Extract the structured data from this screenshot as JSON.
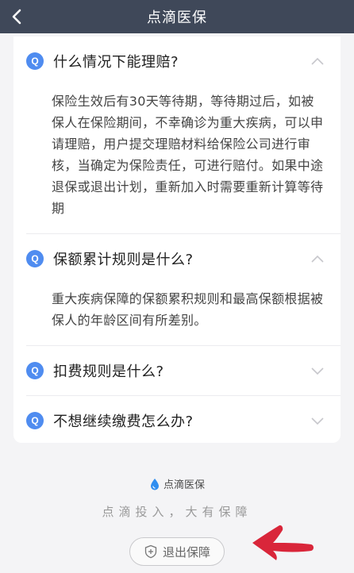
{
  "header": {
    "title": "点滴医保",
    "back_icon": "chevron-left-icon"
  },
  "faq": [
    {
      "question": "什么情况下能理赔?",
      "expanded": true,
      "answer": "保险生效后有30天等待期，等待期过后，如被保人在保险期间，不幸确诊为重大疾病，可以申请理赔，用户提交理赔材料给保险公司进行审核，当确定为保险责任，可进行赔付。如果中途退保或退出计划，重新加入时需要重新计算等待期"
    },
    {
      "question": "保额累计规则是什么?",
      "expanded": true,
      "answer": "重大疾病保障的保额累积规则和最高保额根据被保人的年龄区间有所差别。"
    },
    {
      "question": "扣费规则是什么?",
      "expanded": false,
      "answer": ""
    },
    {
      "question": "不想继续缴费怎么办?",
      "expanded": false,
      "answer": ""
    }
  ],
  "footer": {
    "logo_text": "点滴医保",
    "slogan": "点滴投入，大有保障",
    "exit_button": "退出保障"
  },
  "colors": {
    "header_bg": "#3f4859",
    "accent": "#4f8cf0",
    "annotation_arrow": "#d9263a"
  },
  "icons": {
    "badge": "question-badge-icon",
    "expand": "chevron-down-icon",
    "collapse": "chevron-up-icon",
    "logo": "water-drop-icon",
    "exit": "shield-plus-icon"
  }
}
